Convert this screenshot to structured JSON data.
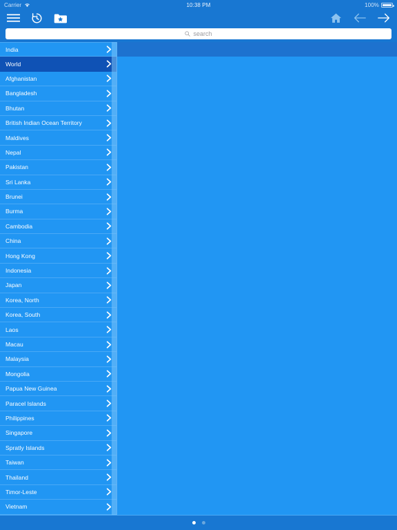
{
  "status_bar": {
    "carrier": "Carrier",
    "wifi_icon": "wifi-icon",
    "time": "10:38 PM",
    "battery_percent": "100%",
    "battery_icon": "battery-full-icon"
  },
  "toolbar": {
    "menu_icon": "hamburger-menu-icon",
    "history_icon": "history-clock-icon",
    "favorites_icon": "folder-star-icon",
    "home_icon": "home-icon",
    "back_icon": "arrow-left-icon",
    "forward_icon": "arrow-right-icon"
  },
  "search": {
    "icon": "search-icon",
    "placeholder": "search",
    "value": ""
  },
  "list": {
    "chevron_icon": "chevron-right-icon",
    "selected": "World",
    "items": [
      {
        "label": "India"
      },
      {
        "label": "World"
      },
      {
        "label": "Afghanistan"
      },
      {
        "label": "Bangladesh"
      },
      {
        "label": "Bhutan"
      },
      {
        "label": "British Indian Ocean Territory"
      },
      {
        "label": "Maldives"
      },
      {
        "label": "Nepal"
      },
      {
        "label": "Pakistan"
      },
      {
        "label": "Sri Lanka"
      },
      {
        "label": "Brunei"
      },
      {
        "label": "Burma"
      },
      {
        "label": "Cambodia"
      },
      {
        "label": "China"
      },
      {
        "label": "Hong Kong"
      },
      {
        "label": "Indonesia"
      },
      {
        "label": "Japan"
      },
      {
        "label": "Korea, North"
      },
      {
        "label": "Korea, South"
      },
      {
        "label": "Laos"
      },
      {
        "label": "Macau"
      },
      {
        "label": "Malaysia"
      },
      {
        "label": "Mongolia"
      },
      {
        "label": "Papua New Guinea"
      },
      {
        "label": "Paracel Islands"
      },
      {
        "label": "Philippines"
      },
      {
        "label": "Singapore"
      },
      {
        "label": "Spratly Islands"
      },
      {
        "label": "Taiwan"
      },
      {
        "label": "Thailand"
      },
      {
        "label": "Timor-Leste"
      },
      {
        "label": "Vietnam"
      }
    ]
  },
  "detail": {
    "header_text": "",
    "body_text": ""
  },
  "page_indicator": {
    "total": 2,
    "active_index": 0
  },
  "colors": {
    "accent": "#2196f3",
    "chrome": "#1877d2",
    "selected_row": "#0f52b5",
    "detail_header": "#1d72cf",
    "separator": "#4aa9f6",
    "text": "#ffffff",
    "placeholder": "#9a9a9f"
  }
}
